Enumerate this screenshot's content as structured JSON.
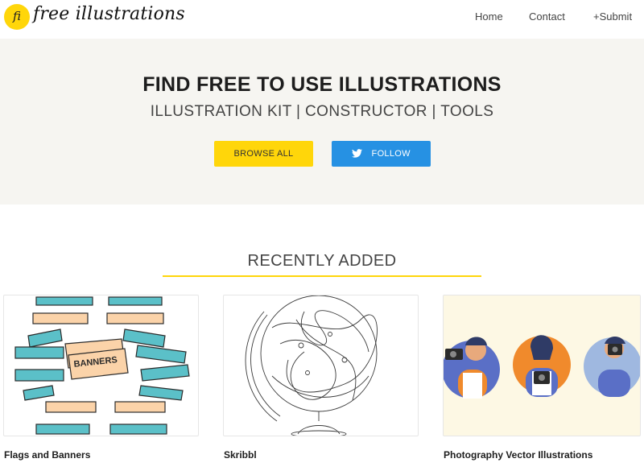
{
  "header": {
    "logo_mark": "fi",
    "logo_text": "free illustrations",
    "nav": {
      "home": "Home",
      "contact": "Contact",
      "submit": "+Submit"
    }
  },
  "hero": {
    "title": "FIND FREE TO USE ILLUSTRATIONS",
    "subtitle": "ILLUSTRATION KIT | CONSTRUCTOR | TOOLS",
    "browse_label": "BROWSE ALL",
    "follow_label": "FOLLOW",
    "follow_icon": "twitter-icon"
  },
  "section": {
    "title": "RECENTLY ADDED"
  },
  "cards": [
    {
      "title": "Flags and Banners",
      "banner_text": "BANNERS"
    },
    {
      "title": "Skribbl"
    },
    {
      "title": "Photography Vector Illustrations"
    }
  ],
  "colors": {
    "accent_yellow": "#ffd60a",
    "twitter_blue": "#2691e3",
    "hero_bg": "#f6f5f1",
    "banner_teal": "#5bc0c8",
    "banner_peach": "#fbd3a9",
    "photo_orange": "#f08a2c",
    "photo_blue": "#9fb8e0"
  }
}
